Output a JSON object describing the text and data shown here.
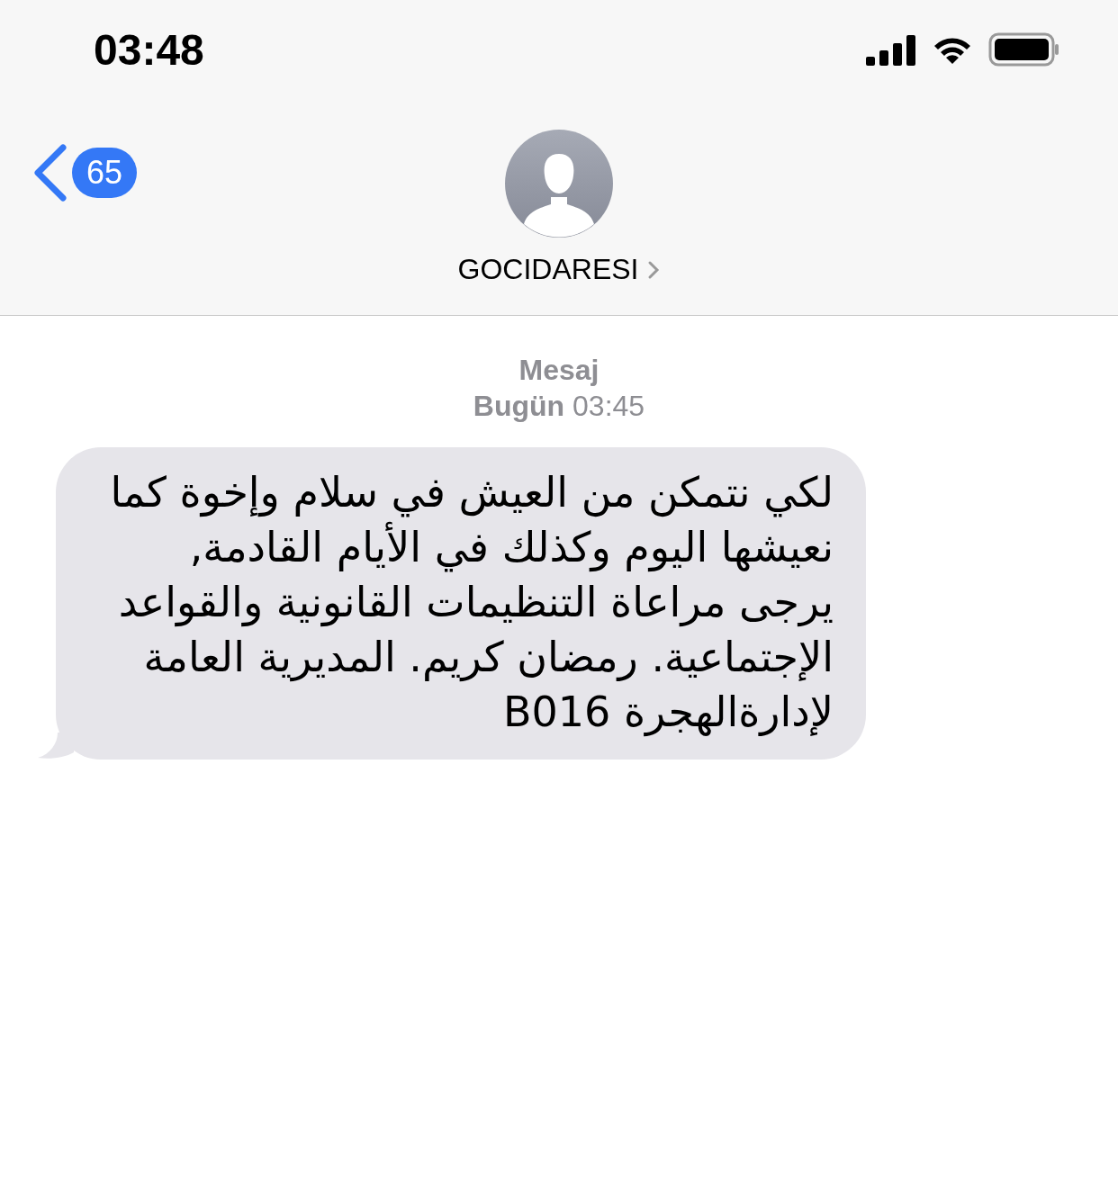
{
  "status_bar": {
    "time": "03:48"
  },
  "header": {
    "back_count": "65",
    "contact_name": "GOCIDARESI"
  },
  "conversation": {
    "service": "Mesaj",
    "timestamp": "**Bugün** 03:45"
  },
  "messages": [
    {
      "kind": "incoming",
      "text": "لكي نتمكن من العيش في سلام وإخوة كما\nنعيشها اليوم وكذلك في الأيام القادمة,\nيرجى مراعاة التنظيمات القانونية والقواعد\nالإجتماعية. رمضان كريم. المديرية العامة\nلإدارةالهجرة B016"
    }
  ]
}
